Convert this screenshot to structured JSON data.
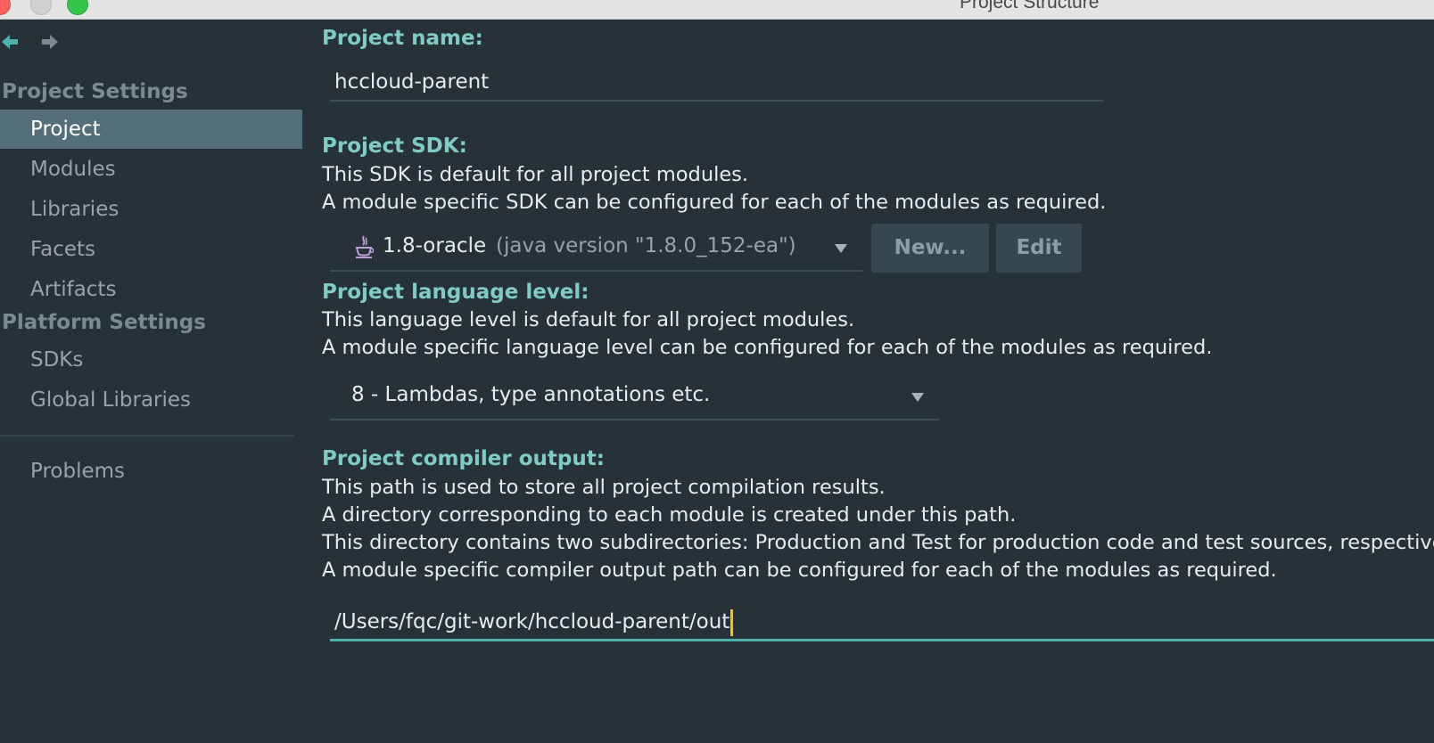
{
  "window": {
    "title": "Project Structure"
  },
  "sidebar": {
    "group_project": "Project Settings",
    "project_items": [
      {
        "label": "Project",
        "selected": true
      },
      {
        "label": "Modules"
      },
      {
        "label": "Libraries"
      },
      {
        "label": "Facets"
      },
      {
        "label": "Artifacts"
      }
    ],
    "group_platform": "Platform Settings",
    "platform_items": [
      {
        "label": "SDKs"
      },
      {
        "label": "Global Libraries"
      }
    ],
    "problems": "Problems"
  },
  "project_name": {
    "label": "Project name:",
    "value": "hccloud-parent"
  },
  "project_sdk": {
    "label": "Project SDK:",
    "desc1": "This SDK is default for all project modules.",
    "desc2": "A module specific SDK can be configured for each of the modules as required.",
    "selected_name": "1.8-oracle",
    "selected_detail": "(java version \"1.8.0_152-ea\")",
    "new_button": "New...",
    "edit_button": "Edit",
    "icon": "java-icon"
  },
  "language_level": {
    "label": "Project language level:",
    "desc1": "This language level is default for all project modules.",
    "desc2": "A module specific language level can be configured for each of the modules as required.",
    "selected": "8 - Lambdas, type annotations etc."
  },
  "compiler_output": {
    "label": "Project compiler output:",
    "desc1": "This path is used to store all project compilation results.",
    "desc2": "A directory corresponding to each module is created under this path.",
    "desc3": "This directory contains two subdirectories: Production and Test for production code and test sources, respectively.",
    "desc4": "A module specific compiler output path can be configured for each of the modules as required.",
    "value": "/Users/fqc/git-work/hccloud-parent/out"
  },
  "colors": {
    "background": "#263238",
    "accent": "#80cbc4",
    "selection": "#546e7a",
    "caret": "#ffc107"
  }
}
